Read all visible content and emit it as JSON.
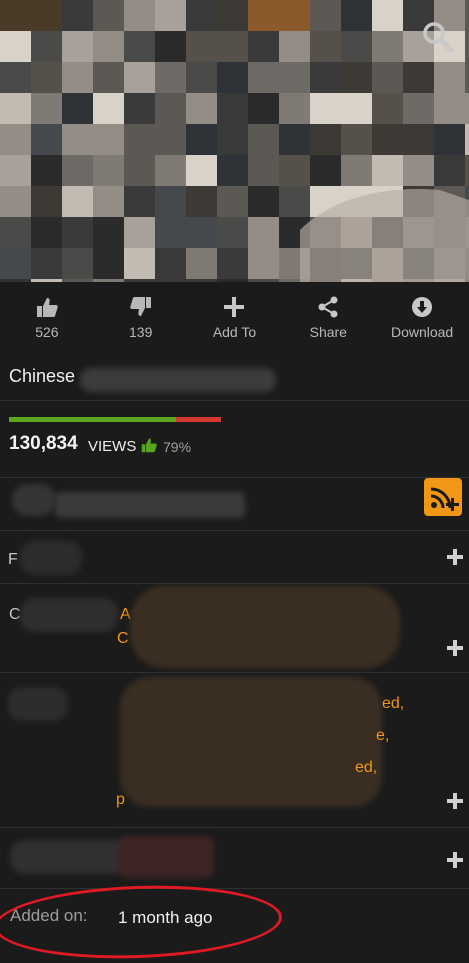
{
  "actions": [
    {
      "label": "526",
      "icon": "thumbs-up-icon"
    },
    {
      "label": "139",
      "icon": "thumbs-down-icon"
    },
    {
      "label": "Add To",
      "icon": "plus-icon"
    },
    {
      "label": "Share",
      "icon": "share-icon"
    },
    {
      "label": "Download",
      "icon": "download-icon"
    }
  ],
  "video": {
    "title": "Chinese"
  },
  "stats": {
    "views": "130,834",
    "views_label": "VIEWS",
    "rating_percent": "79%",
    "rating_fraction": 0.79
  },
  "details": {
    "row_f_stub": "F",
    "row_c_stub": "C",
    "row_c_orange_a": "A",
    "row_c_orange_c": "C",
    "row_tags_frag1": "ed,",
    "row_tags_frag2": "e,",
    "row_tags_frag3": "ed,",
    "row_tags_frag4": "p"
  },
  "added": {
    "label": "Added on:",
    "value": "1 month ago"
  },
  "colors": {
    "accent": "#f29616",
    "like": "#5aa51c",
    "dislike": "#d2382d",
    "annotation": "#e01a24"
  }
}
